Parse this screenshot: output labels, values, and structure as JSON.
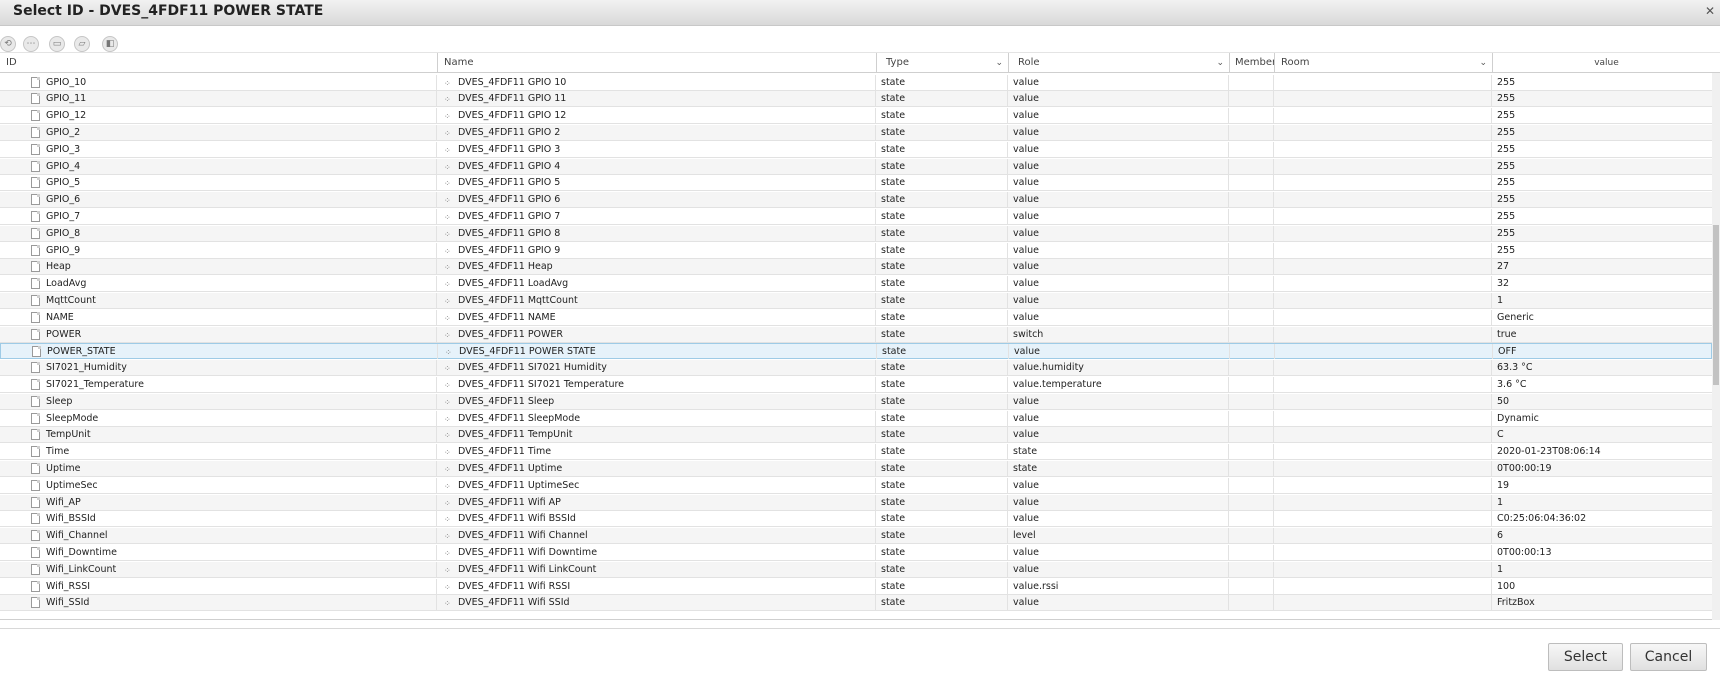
{
  "dialog": {
    "title": "Select ID - DVES_4FDF11 POWER STATE",
    "close_icon": "close-icon"
  },
  "toolbar": {
    "buttons": [
      "refresh-icon",
      "more-icon",
      "folder-icon",
      "folder-open-icon",
      "columns-icon"
    ]
  },
  "columns": {
    "id": "ID",
    "name": "Name",
    "type": "Type",
    "role": "Role",
    "members": "Members",
    "room": "Room",
    "value": "value"
  },
  "rows": [
    {
      "id": "GPIO_10",
      "name": "DVES_4FDF11 GPIO 10",
      "type": "state",
      "role": "value",
      "value": "255"
    },
    {
      "id": "GPIO_11",
      "name": "DVES_4FDF11 GPIO 11",
      "type": "state",
      "role": "value",
      "value": "255"
    },
    {
      "id": "GPIO_12",
      "name": "DVES_4FDF11 GPIO 12",
      "type": "state",
      "role": "value",
      "value": "255"
    },
    {
      "id": "GPIO_2",
      "name": "DVES_4FDF11 GPIO 2",
      "type": "state",
      "role": "value",
      "value": "255"
    },
    {
      "id": "GPIO_3",
      "name": "DVES_4FDF11 GPIO 3",
      "type": "state",
      "role": "value",
      "value": "255"
    },
    {
      "id": "GPIO_4",
      "name": "DVES_4FDF11 GPIO 4",
      "type": "state",
      "role": "value",
      "value": "255"
    },
    {
      "id": "GPIO_5",
      "name": "DVES_4FDF11 GPIO 5",
      "type": "state",
      "role": "value",
      "value": "255"
    },
    {
      "id": "GPIO_6",
      "name": "DVES_4FDF11 GPIO 6",
      "type": "state",
      "role": "value",
      "value": "255"
    },
    {
      "id": "GPIO_7",
      "name": "DVES_4FDF11 GPIO 7",
      "type": "state",
      "role": "value",
      "value": "255"
    },
    {
      "id": "GPIO_8",
      "name": "DVES_4FDF11 GPIO 8",
      "type": "state",
      "role": "value",
      "value": "255"
    },
    {
      "id": "GPIO_9",
      "name": "DVES_4FDF11 GPIO 9",
      "type": "state",
      "role": "value",
      "value": "255"
    },
    {
      "id": "Heap",
      "name": "DVES_4FDF11 Heap",
      "type": "state",
      "role": "value",
      "value": "27"
    },
    {
      "id": "LoadAvg",
      "name": "DVES_4FDF11 LoadAvg",
      "type": "state",
      "role": "value",
      "value": "32"
    },
    {
      "id": "MqttCount",
      "name": "DVES_4FDF11 MqttCount",
      "type": "state",
      "role": "value",
      "value": "1"
    },
    {
      "id": "NAME",
      "name": "DVES_4FDF11 NAME",
      "type": "state",
      "role": "value",
      "value": "Generic"
    },
    {
      "id": "POWER",
      "name": "DVES_4FDF11 POWER",
      "type": "state",
      "role": "switch",
      "value": "true"
    },
    {
      "id": "POWER_STATE",
      "name": "DVES_4FDF11 POWER STATE",
      "type": "state",
      "role": "value",
      "value": "OFF",
      "selected": true
    },
    {
      "id": "SI7021_Humidity",
      "name": "DVES_4FDF11 SI7021 Humidity",
      "type": "state",
      "role": "value.humidity",
      "value": "63.3 °C"
    },
    {
      "id": "SI7021_Temperature",
      "name": "DVES_4FDF11 SI7021 Temperature",
      "type": "state",
      "role": "value.temperature",
      "value": "3.6 °C"
    },
    {
      "id": "Sleep",
      "name": "DVES_4FDF11 Sleep",
      "type": "state",
      "role": "value",
      "value": "50"
    },
    {
      "id": "SleepMode",
      "name": "DVES_4FDF11 SleepMode",
      "type": "state",
      "role": "value",
      "value": "Dynamic"
    },
    {
      "id": "TempUnit",
      "name": "DVES_4FDF11 TempUnit",
      "type": "state",
      "role": "value",
      "value": "C"
    },
    {
      "id": "Time",
      "name": "DVES_4FDF11 Time",
      "type": "state",
      "role": "state",
      "value": "2020-01-23T08:06:14"
    },
    {
      "id": "Uptime",
      "name": "DVES_4FDF11 Uptime",
      "type": "state",
      "role": "state",
      "value": "0T00:00:19"
    },
    {
      "id": "UptimeSec",
      "name": "DVES_4FDF11 UptimeSec",
      "type": "state",
      "role": "value",
      "value": "19"
    },
    {
      "id": "Wifi_AP",
      "name": "DVES_4FDF11 Wifi AP",
      "type": "state",
      "role": "value",
      "value": "1"
    },
    {
      "id": "Wifi_BSSId",
      "name": "DVES_4FDF11 Wifi BSSId",
      "type": "state",
      "role": "value",
      "value": "C0:25:06:04:36:02"
    },
    {
      "id": "Wifi_Channel",
      "name": "DVES_4FDF11 Wifi Channel",
      "type": "state",
      "role": "level",
      "value": "6"
    },
    {
      "id": "Wifi_Downtime",
      "name": "DVES_4FDF11 Wifi Downtime",
      "type": "state",
      "role": "value",
      "value": "0T00:00:13"
    },
    {
      "id": "Wifi_LinkCount",
      "name": "DVES_4FDF11 Wifi LinkCount",
      "type": "state",
      "role": "value",
      "value": "1"
    },
    {
      "id": "Wifi_RSSI",
      "name": "DVES_4FDF11 Wifi RSSI",
      "type": "state",
      "role": "value.rssi",
      "value": "100"
    },
    {
      "id": "Wifi_SSId",
      "name": "DVES_4FDF11 Wifi SSId",
      "type": "state",
      "role": "value",
      "value": "FritzBox"
    }
  ],
  "footer": {
    "select_label": "Select",
    "cancel_label": "Cancel"
  }
}
